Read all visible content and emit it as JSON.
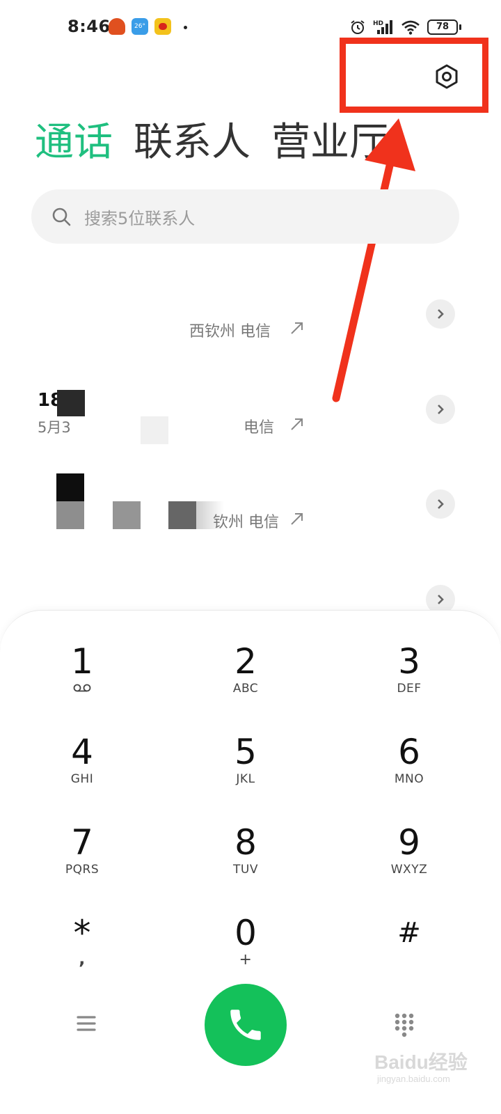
{
  "status_bar": {
    "time": "8:46",
    "weather_temp": "26°",
    "battery": "78"
  },
  "tabs": [
    {
      "label": "通话",
      "active": true
    },
    {
      "label": "联系人",
      "active": false
    },
    {
      "label": "营业厅",
      "active": false
    }
  ],
  "search": {
    "placeholder": "搜索5位联系人"
  },
  "call_log": [
    {
      "name": "",
      "date": "",
      "location": "西钦州 电信"
    },
    {
      "name": "18",
      "date": "5月3",
      "location": "电信"
    },
    {
      "name": "",
      "date": "",
      "location": "钦州 电信"
    },
    {
      "name": "",
      "date": "",
      "location": ""
    }
  ],
  "dialpad": {
    "keys": [
      {
        "digit": "1",
        "letters": ""
      },
      {
        "digit": "2",
        "letters": "ABC"
      },
      {
        "digit": "3",
        "letters": "DEF"
      },
      {
        "digit": "4",
        "letters": "GHI"
      },
      {
        "digit": "5",
        "letters": "JKL"
      },
      {
        "digit": "6",
        "letters": "MNO"
      },
      {
        "digit": "7",
        "letters": "PQRS"
      },
      {
        "digit": "8",
        "letters": "TUV"
      },
      {
        "digit": "9",
        "letters": "WXYZ"
      },
      {
        "digit": "*",
        "letters": ","
      },
      {
        "digit": "0",
        "letters": "+"
      },
      {
        "digit": "#",
        "letters": ""
      }
    ]
  },
  "colors": {
    "accent": "#1fbf7f",
    "call_button": "#14c15a",
    "highlight": "#f0321c"
  },
  "icons": [
    "settings-icon",
    "search-icon",
    "chevron-right-icon",
    "call-outgoing-icon",
    "voicemail-icon",
    "menu-icon",
    "phone-icon",
    "dialpad-icon",
    "alarm-icon",
    "signal-icon",
    "wifi-icon",
    "battery-icon"
  ],
  "watermark": {
    "logo": "Baidu经验",
    "url": "jingyan.baidu.com"
  }
}
